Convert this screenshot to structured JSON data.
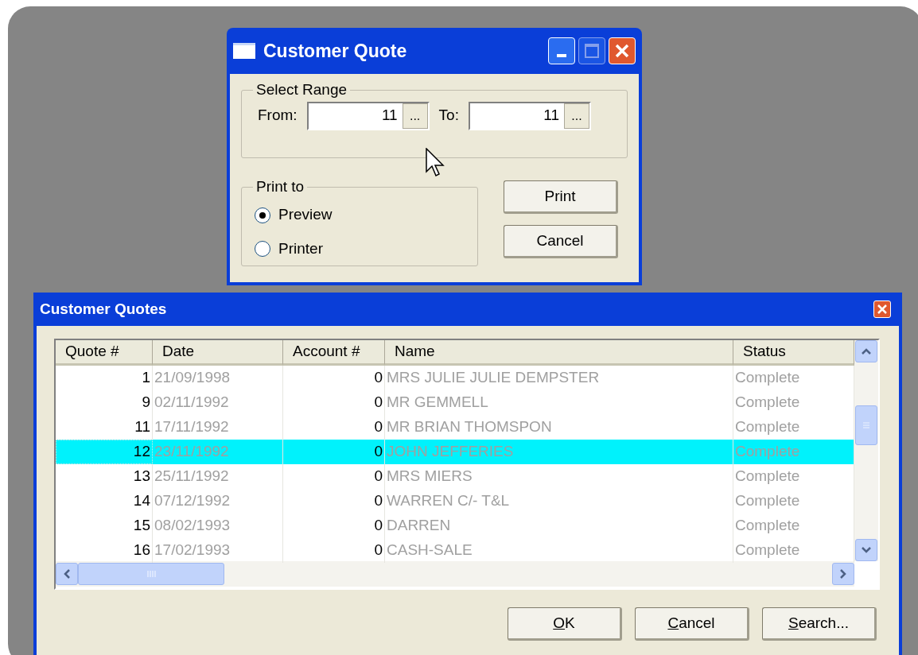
{
  "quote_dialog": {
    "title": "Customer Quote",
    "title_buttons": [
      {
        "kind": "minimize",
        "disabled": false
      },
      {
        "kind": "maximize",
        "disabled": true
      },
      {
        "kind": "close",
        "disabled": false
      }
    ],
    "range_group": {
      "label": "Select Range",
      "from_label": "From:",
      "from_value": "11",
      "from_button": "...",
      "to_label": "To:",
      "to_value": "11",
      "to_button": "..."
    },
    "print_group": {
      "label": "Print to",
      "options": [
        {
          "label": "Preview",
          "selected": true
        },
        {
          "label": "Printer",
          "selected": false
        }
      ]
    },
    "buttons": [
      "Print",
      "Cancel"
    ]
  },
  "quotes_window": {
    "title": "Customer Quotes",
    "table": {
      "columns": [
        "Quote #",
        "Date",
        "Account #",
        "Name",
        "Status"
      ],
      "rows": [
        {
          "quote": "1",
          "date": "21/09/1998",
          "account": "0",
          "name": "MRS JULIE JULIE DEMPSTER",
          "status": "Complete",
          "selected": false
        },
        {
          "quote": "9",
          "date": "02/11/1992",
          "account": "0",
          "name": "MR GEMMELL",
          "status": "Complete",
          "selected": false
        },
        {
          "quote": "11",
          "date": "17/11/1992",
          "account": "0",
          "name": "MR BRIAN THOMSPON",
          "status": "Complete",
          "selected": false
        },
        {
          "quote": "12",
          "date": "23/11/1992",
          "account": "0",
          "name": "JOHN JEFFERIES",
          "status": "Complete",
          "selected": true
        },
        {
          "quote": "13",
          "date": "25/11/1992",
          "account": "0",
          "name": "MRS MIERS",
          "status": "Complete",
          "selected": false
        },
        {
          "quote": "14",
          "date": "07/12/1992",
          "account": "0",
          "name": "WARREN C/- T&L",
          "status": "Complete",
          "selected": false
        },
        {
          "quote": "15",
          "date": "08/02/1993",
          "account": "0",
          "name": "DARREN",
          "status": "Complete",
          "selected": false
        },
        {
          "quote": "16",
          "date": "17/02/1993",
          "account": "0",
          "name": "CASH-SALE",
          "status": "Complete",
          "selected": false
        }
      ]
    },
    "buttons": [
      {
        "label": "OK",
        "underline_first": true
      },
      {
        "label": "Cancel",
        "underline_first": true
      },
      {
        "label": "Search...",
        "underline_first": true
      }
    ]
  }
}
